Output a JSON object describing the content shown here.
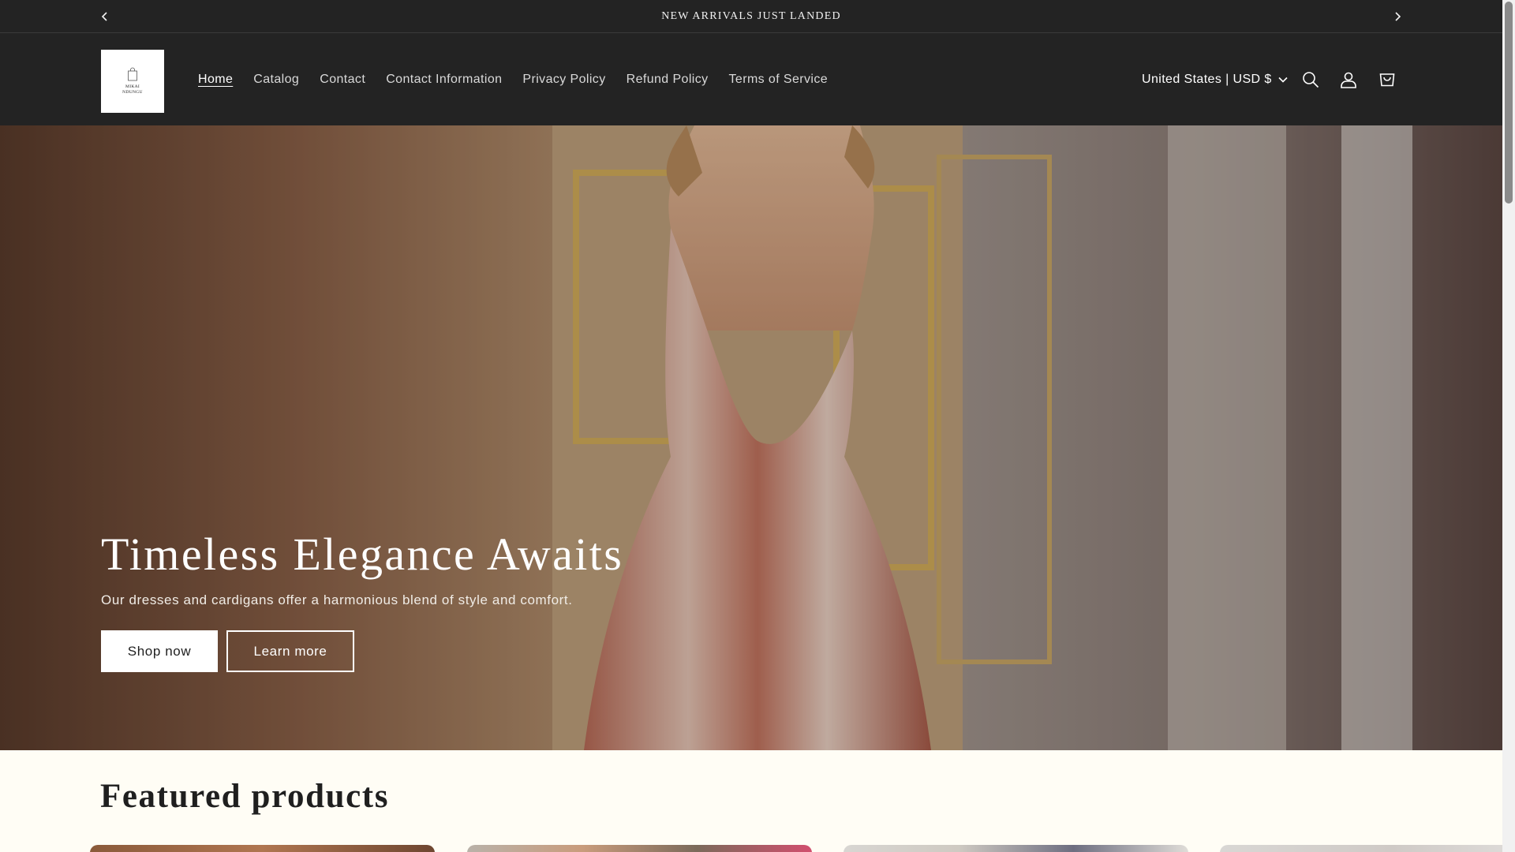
{
  "announcement": {
    "text": "NEW ARRIVALS JUST LANDED",
    "prev_icon": "chevron-left-icon",
    "next_icon": "chevron-right-icon"
  },
  "header": {
    "logo": {
      "line1": "MIKAI",
      "line2": "NDUNGU"
    },
    "nav": [
      {
        "label": "Home",
        "active": true
      },
      {
        "label": "Catalog"
      },
      {
        "label": "Contact"
      },
      {
        "label": "Contact Information"
      },
      {
        "label": "Privacy Policy"
      },
      {
        "label": "Refund Policy"
      },
      {
        "label": "Terms of Service"
      }
    ],
    "country_selector": "United States | USD $",
    "icons": [
      "search-icon",
      "account-icon",
      "cart-icon"
    ]
  },
  "hero": {
    "title": "Timeless Elegance Awaits",
    "subtitle": "Our dresses and cardigans offer a harmonious blend of style and comfort.",
    "primary_button": "Shop now",
    "secondary_button": "Learn more"
  },
  "featured": {
    "title": "Featured products"
  },
  "colors": {
    "header_bg": "#232323",
    "page_bg": "#fffdf5",
    "text_dark": "#1f1f1f",
    "button_bg": "#ffffff"
  }
}
